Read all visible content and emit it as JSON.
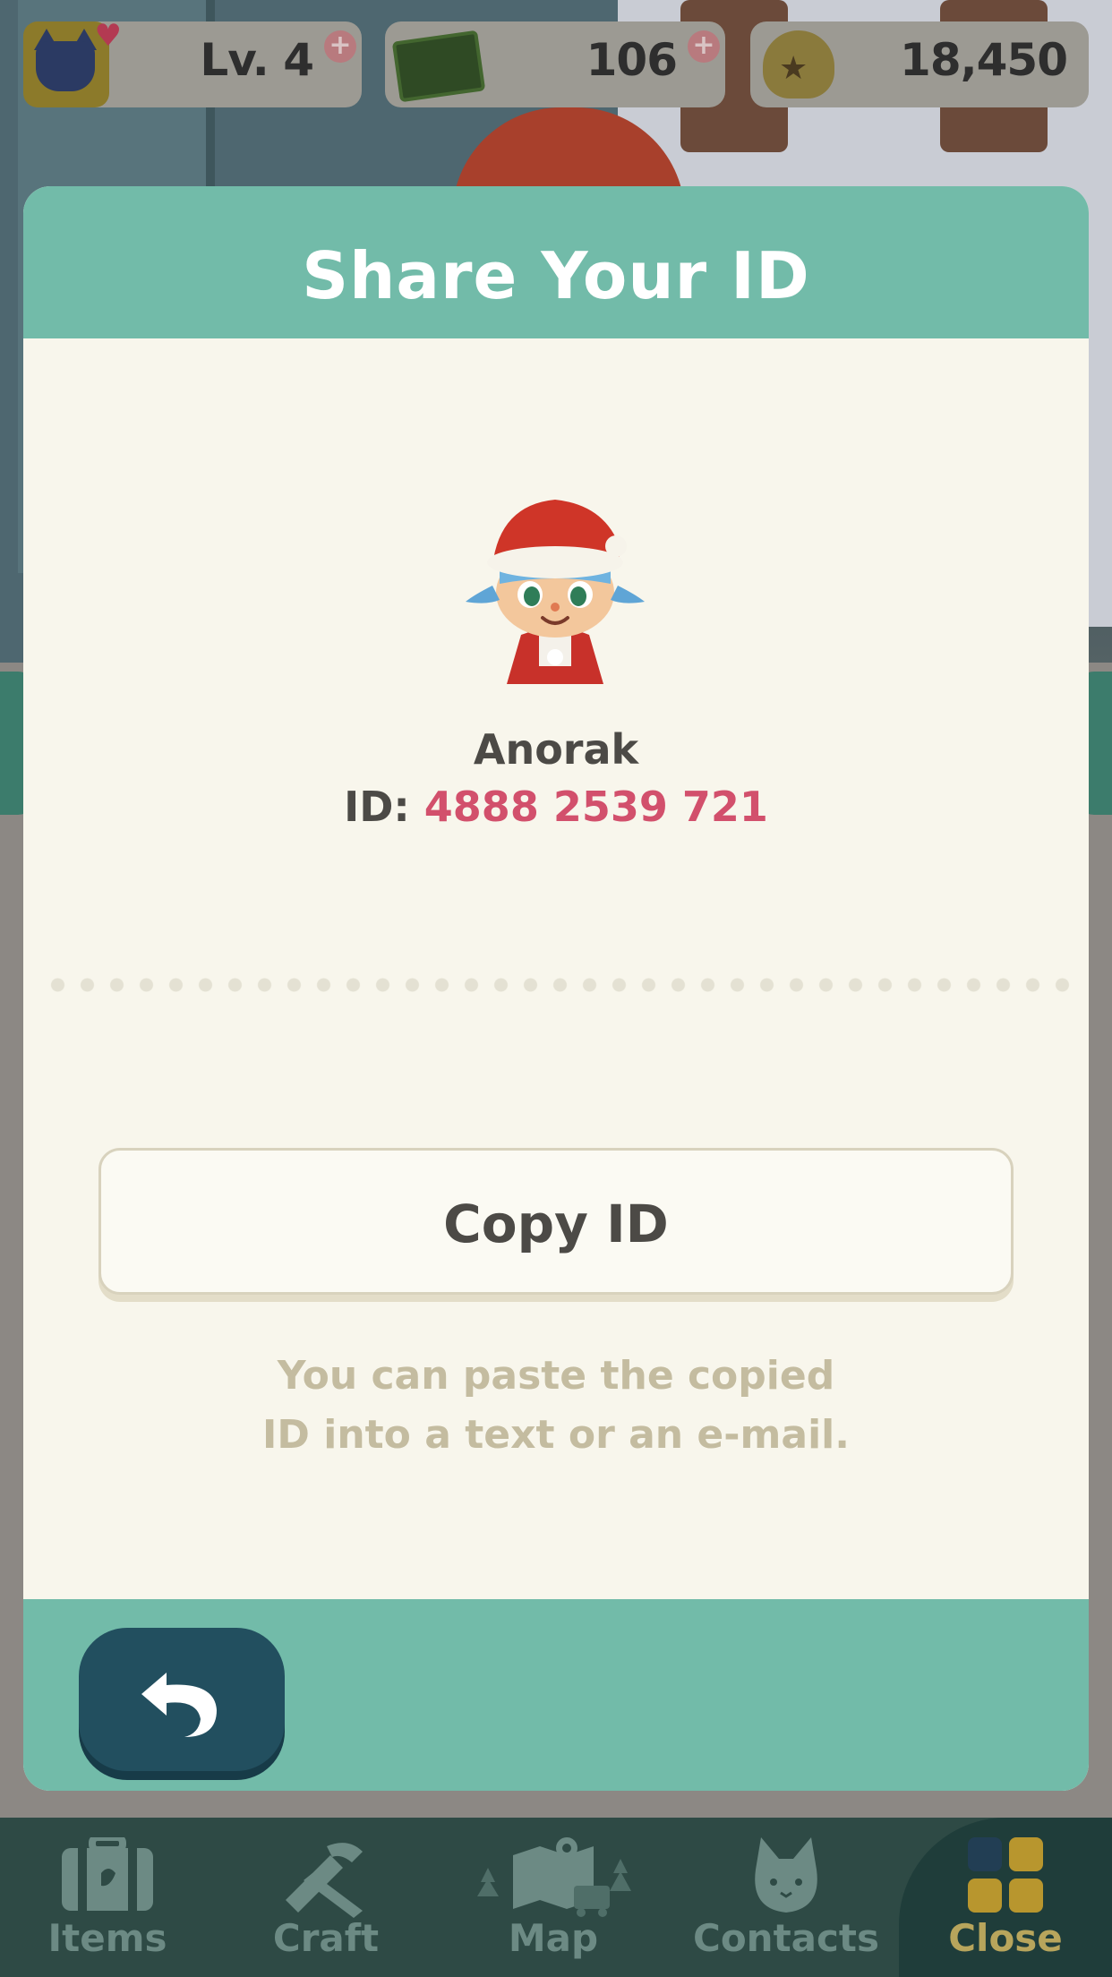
{
  "status_bar": {
    "level_label": "Lv. 4",
    "tickets": "106",
    "bells": "18,450"
  },
  "modal": {
    "title": "Share Your ID",
    "player_name": "Anorak",
    "id_prefix": "ID:",
    "id_number": "4888 2539 721",
    "copy_button": "Copy ID",
    "hint_line1": "You can paste the copied",
    "hint_line2": "ID into a text or an e-mail."
  },
  "bottom_nav": {
    "items": [
      {
        "label": "Items",
        "icon": "suitcase-icon"
      },
      {
        "label": "Craft",
        "icon": "craft-tools-icon"
      },
      {
        "label": "Map",
        "icon": "map-icon"
      },
      {
        "label": "Contacts",
        "icon": "cat-face-icon"
      },
      {
        "label": "Close",
        "icon": "grid-icon"
      }
    ]
  },
  "colors": {
    "header_teal": "#72bba9",
    "modal_bg": "#f8f6ec",
    "id_pink": "#d2506c",
    "back_button": "#224f5f",
    "nav_bg": "#2e4a45"
  }
}
